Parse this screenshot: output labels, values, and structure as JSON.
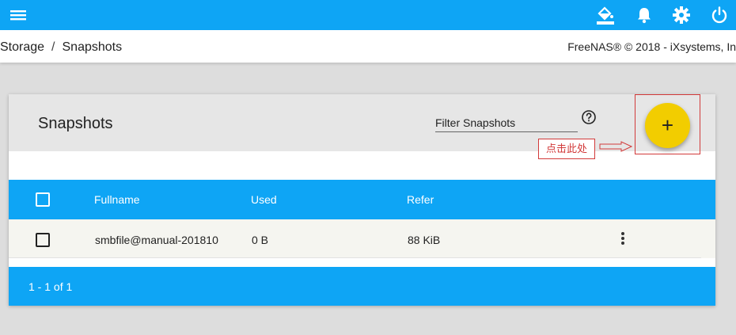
{
  "topbar": {
    "icons": [
      "menu-icon",
      "paint-bucket-icon",
      "bell-icon",
      "gear-icon",
      "power-icon"
    ],
    "color": "#0ea5f5"
  },
  "breadcrumb": {
    "items": [
      "Storage",
      "Snapshots"
    ],
    "separator": "/"
  },
  "copyright": "FreeNAS® © 2018 - iXsystems, In",
  "card": {
    "title": "Snapshots",
    "filter_placeholder": "Filter Snapshots",
    "fab_label": "+"
  },
  "annotation": {
    "text": "点击此处",
    "color": "#d23a3a"
  },
  "table": {
    "columns": [
      "Fullname",
      "Used",
      "Refer"
    ],
    "rows": [
      {
        "fullname": "smbfile@manual-201810",
        "used": "0 B",
        "refer": "88 KiB"
      }
    ]
  },
  "pagination": "1 - 1 of 1",
  "colors": {
    "accent": "#0ea5f5",
    "fab": "#f2cd00"
  }
}
